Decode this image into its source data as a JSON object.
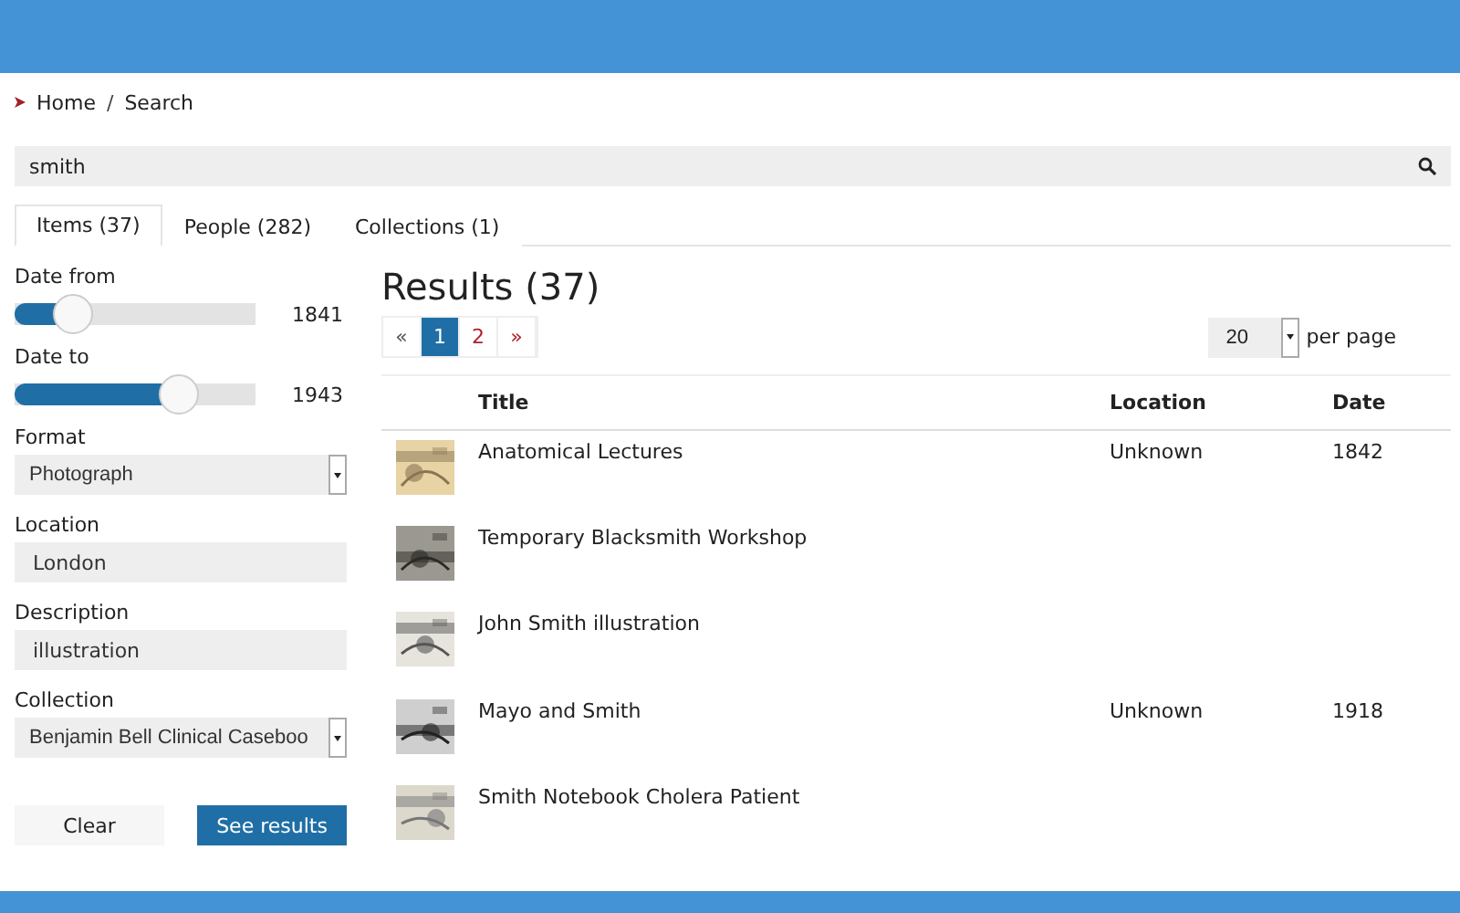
{
  "breadcrumb": {
    "items": [
      "Home",
      "Search"
    ],
    "separator": "/"
  },
  "search": {
    "value": "smith"
  },
  "tabs": [
    {
      "label": "Items (37)",
      "selected": true
    },
    {
      "label": "People (282)",
      "selected": false
    },
    {
      "label": "Collections (1)",
      "selected": false
    }
  ],
  "filters": [
    {
      "kind": "slider",
      "label": "Date from",
      "level": 0.24,
      "reading": "1841"
    },
    {
      "kind": "slider",
      "label": "Date to",
      "level": 0.68,
      "reading": "1943"
    },
    {
      "kind": "select",
      "label": "Format",
      "value": "Photograph"
    },
    {
      "kind": "text",
      "label": "Location",
      "value": "London"
    },
    {
      "kind": "text",
      "label": "Description",
      "value": "illustration"
    },
    {
      "kind": "select",
      "label": "Collection",
      "value": "Benjamin Bell Clinical Caseboo"
    }
  ],
  "buttons": [
    {
      "label": "Clear",
      "kind": "secondary"
    },
    {
      "label": "See results",
      "kind": "primary"
    }
  ],
  "results": {
    "heading": "Results (37)",
    "pages": [
      {
        "label": "«",
        "selected": false,
        "disabled": true
      },
      {
        "label": "1",
        "selected": true,
        "disabled": false
      },
      {
        "label": "2",
        "selected": false,
        "disabled": false
      },
      {
        "label": "»",
        "selected": false,
        "disabled": false
      }
    ],
    "per_page": {
      "value": "20",
      "label": "per page"
    },
    "columns": [
      "Title",
      "Location",
      "Date"
    ],
    "rows": [
      {
        "title": "Anatomical Lectures",
        "location": "Unknown",
        "date": "1842"
      },
      {
        "title": "Temporary Blacksmith Workshop"
      },
      {
        "title": "John Smith illustration"
      },
      {
        "title": "Mayo and Smith",
        "location": "Unknown",
        "date": "1918"
      },
      {
        "title": "Smith Notebook Cholera Patient"
      }
    ]
  }
}
